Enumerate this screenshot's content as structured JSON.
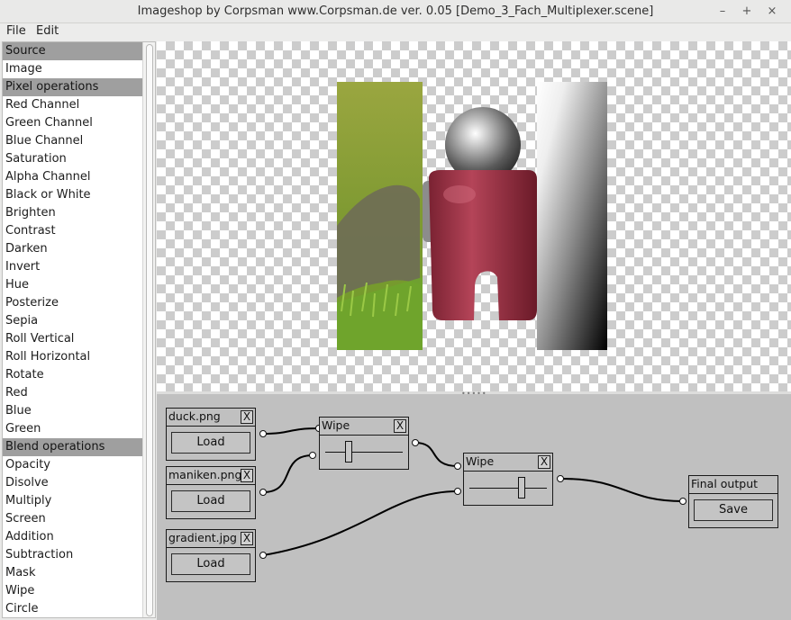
{
  "window": {
    "title": "Imageshop by Corpsman www.Corpsman.de ver. 0.05 [Demo_3_Fach_Multiplexer.scene]",
    "controls": {
      "minimize": "–",
      "maximize": "+",
      "close": "×"
    }
  },
  "menu": {
    "file": "File",
    "edit": "Edit"
  },
  "sidebar": {
    "items": [
      {
        "label": "Source",
        "header": true
      },
      {
        "label": "Image",
        "header": false
      },
      {
        "label": "Pixel operations",
        "header": true
      },
      {
        "label": "Red Channel",
        "header": false
      },
      {
        "label": "Green Channel",
        "header": false
      },
      {
        "label": "Blue Channel",
        "header": false
      },
      {
        "label": "Saturation",
        "header": false
      },
      {
        "label": "Alpha Channel",
        "header": false
      },
      {
        "label": "Black or White",
        "header": false
      },
      {
        "label": "Brighten",
        "header": false
      },
      {
        "label": "Contrast",
        "header": false
      },
      {
        "label": "Darken",
        "header": false
      },
      {
        "label": "Invert",
        "header": false
      },
      {
        "label": "Hue",
        "header": false
      },
      {
        "label": "Posterize",
        "header": false
      },
      {
        "label": "Sepia",
        "header": false
      },
      {
        "label": "Roll Vertical",
        "header": false
      },
      {
        "label": "Roll Horizontal",
        "header": false
      },
      {
        "label": "Rotate",
        "header": false
      },
      {
        "label": "Red",
        "header": false
      },
      {
        "label": "Blue",
        "header": false
      },
      {
        "label": "Green",
        "header": false
      },
      {
        "label": "Blend operations",
        "header": true
      },
      {
        "label": "Opacity",
        "header": false
      },
      {
        "label": "Disolve",
        "header": false
      },
      {
        "label": "Multiply",
        "header": false
      },
      {
        "label": "Screen",
        "header": false
      },
      {
        "label": "Addition",
        "header": false
      },
      {
        "label": "Subtraction",
        "header": false
      },
      {
        "label": "Mask",
        "header": false
      },
      {
        "label": "Wipe",
        "header": false
      },
      {
        "label": "Circle",
        "header": false
      }
    ]
  },
  "graph": {
    "nodes": {
      "duck": {
        "title": "duck.png",
        "close": "X",
        "button": "Load"
      },
      "maniken": {
        "title": "maniken.png",
        "close": "X",
        "button": "Load"
      },
      "gradient": {
        "title": "gradient.jpg",
        "close": "X",
        "button": "Load"
      },
      "wipe1": {
        "title": "Wipe",
        "close": "X",
        "slider_value": 0.3
      },
      "wipe2": {
        "title": "Wipe",
        "close": "X",
        "slider_value": 0.67
      },
      "final": {
        "title": "Final output",
        "button": "Save"
      }
    }
  },
  "colors": {
    "graph_background": "#c0c0c0",
    "category_header": "#9f9f9f",
    "checker_dark": "#cccccc",
    "checker_light": "#ffffff"
  }
}
